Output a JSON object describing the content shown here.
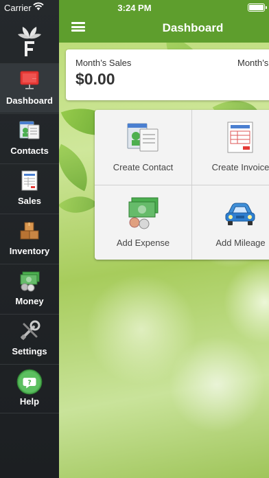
{
  "status_bar": {
    "carrier": "Carrier",
    "time": "3:24 PM"
  },
  "header": {
    "title": "Dashboard"
  },
  "sidebar": {
    "items": [
      {
        "label": "Dashboard",
        "icon": "dashboard-icon",
        "active": true
      },
      {
        "label": "Contacts",
        "icon": "contacts-icon"
      },
      {
        "label": "Sales",
        "icon": "sales-icon"
      },
      {
        "label": "Inventory",
        "icon": "inventory-icon"
      },
      {
        "label": "Money",
        "icon": "money-icon"
      },
      {
        "label": "Settings",
        "icon": "settings-icon"
      },
      {
        "label": "Help",
        "icon": "help-icon"
      }
    ]
  },
  "summary": {
    "months_sales_label": "Month’s Sales",
    "months_sales_value": "$0.00",
    "second_label": "Month’s"
  },
  "actions": [
    {
      "label": "Create Contact",
      "icon": "create-contact-icon"
    },
    {
      "label": "Create Invoice",
      "icon": "create-invoice-icon"
    },
    {
      "label": "Add Expense",
      "icon": "add-expense-icon"
    },
    {
      "label": "Add Mileage",
      "icon": "add-mileage-icon"
    }
  ],
  "colors": {
    "header_green": "#5e9e2d",
    "sidebar_bg": "#1f2326",
    "help_green": "#4caf50"
  }
}
